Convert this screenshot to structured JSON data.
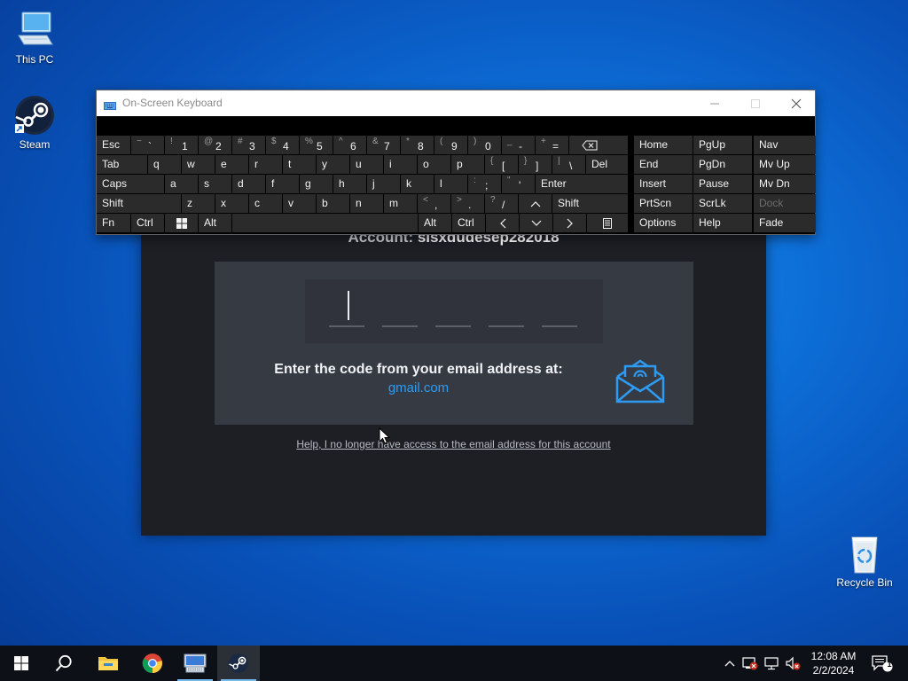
{
  "desktop": {
    "icons": [
      {
        "label": "This PC",
        "icon": "this-pc-icon"
      },
      {
        "label": "Steam",
        "icon": "steam-icon"
      },
      {
        "label": "Recycle Bin",
        "icon": "recycle-bin-icon"
      }
    ]
  },
  "steam_dialog": {
    "account_prefix": "Account:",
    "account_name": "sisxdudesep282018",
    "code_slots": 5,
    "message": "Enter the code from your email address at:",
    "email_domain": "gmail.com",
    "help_link": "Help, I no longer have access to the email address for this account",
    "icon": "email-envelope-icon"
  },
  "osk": {
    "title": "On-Screen Keyboard",
    "title_icon": "keyboard-icon",
    "controls": [
      "minimize-icon",
      "maximize-icon",
      "close-icon"
    ],
    "rows": [
      [
        {
          "label": "Esc"
        },
        {
          "shift": "~",
          "main": "`"
        },
        {
          "shift": "!",
          "main": "1"
        },
        {
          "shift": "@",
          "main": "2"
        },
        {
          "shift": "#",
          "main": "3"
        },
        {
          "shift": "$",
          "main": "4"
        },
        {
          "shift": "%",
          "main": "5"
        },
        {
          "shift": "^",
          "main": "6"
        },
        {
          "shift": "&",
          "main": "7"
        },
        {
          "shift": "*",
          "main": "8"
        },
        {
          "shift": "(",
          "main": "9"
        },
        {
          "shift": ")",
          "main": "0"
        },
        {
          "shift": "_",
          "main": "-"
        },
        {
          "shift": "+",
          "main": "="
        },
        {
          "icon": "backspace-icon"
        },
        {
          "label": "Home"
        },
        {
          "label": "PgUp"
        },
        {
          "label": "Nav"
        }
      ],
      [
        {
          "label": "Tab"
        },
        {
          "label": "q"
        },
        {
          "label": "w"
        },
        {
          "label": "e"
        },
        {
          "label": "r"
        },
        {
          "label": "t"
        },
        {
          "label": "y"
        },
        {
          "label": "u"
        },
        {
          "label": "i"
        },
        {
          "label": "o"
        },
        {
          "label": "p"
        },
        {
          "shift": "{",
          "main": "["
        },
        {
          "shift": "}",
          "main": "]"
        },
        {
          "shift": "|",
          "main": "\\"
        },
        {
          "label": "Del"
        },
        {
          "label": "End"
        },
        {
          "label": "PgDn"
        },
        {
          "label": "Mv Up"
        }
      ],
      [
        {
          "label": "Caps"
        },
        {
          "label": "a"
        },
        {
          "label": "s"
        },
        {
          "label": "d"
        },
        {
          "label": "f"
        },
        {
          "label": "g"
        },
        {
          "label": "h"
        },
        {
          "label": "j"
        },
        {
          "label": "k"
        },
        {
          "label": "l"
        },
        {
          "shift": ":",
          "main": ";"
        },
        {
          "shift": "\"",
          "main": "'"
        },
        {
          "label": "Enter"
        },
        {
          "label": "Insert"
        },
        {
          "label": "Pause"
        },
        {
          "label": "Mv Dn"
        }
      ],
      [
        {
          "label": "Shift"
        },
        {
          "label": "z"
        },
        {
          "label": "x"
        },
        {
          "label": "c"
        },
        {
          "label": "v"
        },
        {
          "label": "b"
        },
        {
          "label": "n"
        },
        {
          "label": "m"
        },
        {
          "shift": "<",
          "main": ","
        },
        {
          "shift": ">",
          "main": "."
        },
        {
          "shift": "?",
          "main": "/"
        },
        {
          "icon": "arrow-up-icon"
        },
        {
          "label": "Shift"
        },
        {
          "label": "PrtScn"
        },
        {
          "label": "ScrLk"
        },
        {
          "label": "Dock",
          "disabled": true
        }
      ],
      [
        {
          "label": "Fn"
        },
        {
          "label": "Ctrl"
        },
        {
          "icon": "windows-logo-icon"
        },
        {
          "label": "Alt"
        },
        {
          "label": ""
        },
        {
          "label": "Alt"
        },
        {
          "label": "Ctrl"
        },
        {
          "icon": "arrow-left-icon"
        },
        {
          "icon": "arrow-down-icon"
        },
        {
          "icon": "arrow-right-icon"
        },
        {
          "icon": "context-menu-icon"
        },
        {
          "label": "Options"
        },
        {
          "label": "Help"
        },
        {
          "label": "Fade"
        }
      ]
    ]
  },
  "taskbar": {
    "items": [
      "start-icon",
      "search-icon",
      "file-explorer-icon",
      "chrome-icon",
      "on-screen-keyboard-icon",
      "steam-icon"
    ],
    "active": "steam-icon",
    "tray": [
      "chevron-up-icon",
      "security-icon",
      "network-icon",
      "volume-muted-icon"
    ],
    "time": "12:08 AM",
    "date": "2/2/2024",
    "notification_count": "1"
  },
  "colors": {
    "desktop_bg": "#0d6fd8",
    "dialog_bg": "#1e1f25",
    "panel_bg": "#363a43",
    "link_blue": "#2e9bf2",
    "key_bg": "#2b2b2b",
    "taskbar_bg": "#0d1117"
  }
}
